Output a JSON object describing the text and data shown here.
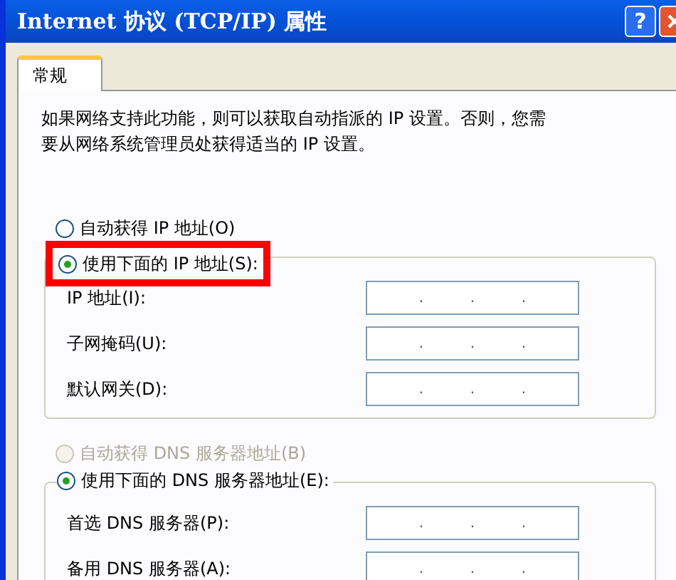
{
  "window": {
    "title": "Internet 协议 (TCP/IP) 属性",
    "buttons": [
      {
        "kind": "help",
        "label": "?"
      },
      {
        "kind": "close"
      }
    ]
  },
  "tabs": [
    {
      "label": "常规",
      "selected": true
    }
  ],
  "description": "如果网络支持此功能，则可以获取自动指派的 IP 设置。否则，您需要从网络系统管理员处获得适当的 IP 设置。",
  "ip_options": [
    {
      "label": "自动获得 IP 地址(O)",
      "selected": false,
      "disabled": false,
      "highlighted": false
    },
    {
      "label": "使用下面的 IP 地址(S):",
      "selected": true,
      "disabled": false,
      "highlighted": true
    }
  ],
  "ip_fields": [
    {
      "label": "IP 地址(I):",
      "separators": [
        ".",
        ".",
        "."
      ]
    },
    {
      "label": "子网掩码(U):",
      "separators": [
        ".",
        ".",
        "."
      ]
    },
    {
      "label": "默认网关(D):",
      "separators": [
        ".",
        ".",
        "."
      ]
    }
  ],
  "dns_options": [
    {
      "label": "自动获得 DNS 服务器地址(B)",
      "selected": false,
      "disabled": true,
      "highlighted": false
    },
    {
      "label": "使用下面的 DNS 服务器地址(E):",
      "selected": true,
      "disabled": false,
      "highlighted": false
    }
  ],
  "dns_fields": [
    {
      "label": "首选 DNS 服务器(P):",
      "separators": [
        ".",
        ".",
        "."
      ]
    },
    {
      "label": "备用 DNS 服务器(A):",
      "separators": [
        ".",
        ".",
        "."
      ]
    }
  ]
}
